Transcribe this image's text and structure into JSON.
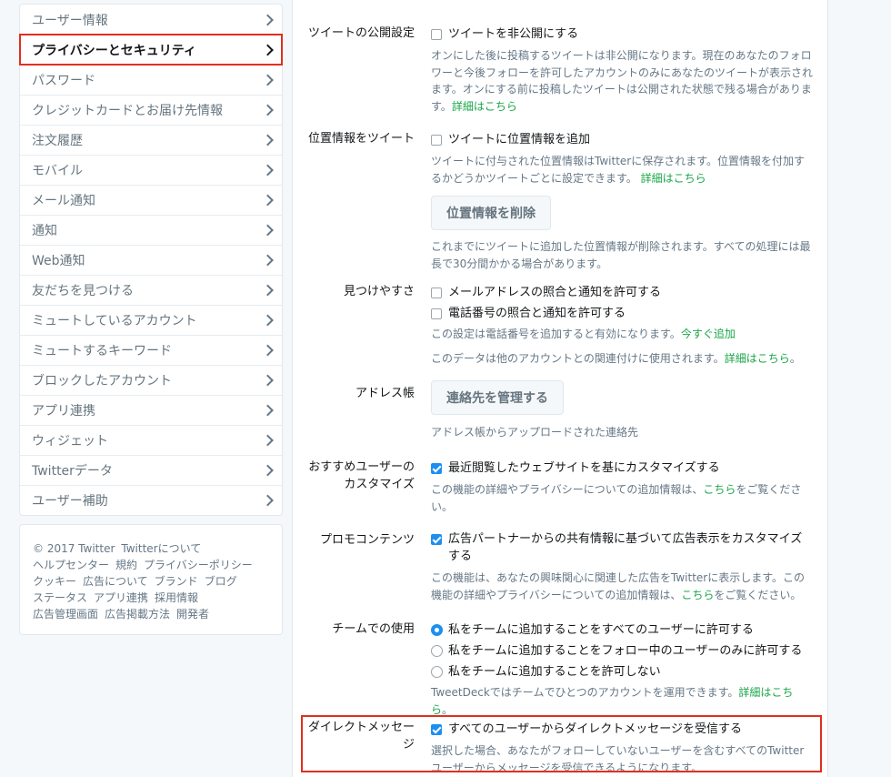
{
  "sidebar": {
    "items": [
      {
        "label": "ユーザー情報"
      },
      {
        "label": "プライバシーとセキュリティ"
      },
      {
        "label": "パスワード"
      },
      {
        "label": "クレジットカードとお届け先情報"
      },
      {
        "label": "注文履歴"
      },
      {
        "label": "モバイル"
      },
      {
        "label": "メール通知"
      },
      {
        "label": "通知"
      },
      {
        "label": "Web通知"
      },
      {
        "label": "友だちを見つける"
      },
      {
        "label": "ミュートしているアカウント"
      },
      {
        "label": "ミュートするキーワード"
      },
      {
        "label": "ブロックしたアカウント"
      },
      {
        "label": "アプリ連携"
      },
      {
        "label": "ウィジェット"
      },
      {
        "label": "Twitterデータ"
      },
      {
        "label": "ユーザー補助"
      }
    ]
  },
  "footer": {
    "copyright": "© 2017 Twitter",
    "links": [
      "Twitterについて",
      "ヘルプセンター",
      "規約",
      "プライバシーポリシー",
      "クッキー",
      "広告について",
      "ブランド",
      "ブログ",
      "ステータス",
      "アプリ連携",
      "採用情報",
      "広告管理画面",
      "広告掲載方法",
      "開発者"
    ]
  },
  "protect": {
    "label": "ツイートの公開設定",
    "option": "ツイートを非公開にする",
    "help": "オンにした後に投稿するツイートは非公開になります。現在のあなたのフォロワーと今後フォローを許可したアカウントのみにあなたのツイートが表示されます。オンにする前に投稿したツイートは公開された状態で残る場合があります。",
    "link": "詳細はこちら"
  },
  "location": {
    "label": "位置情報をツイート",
    "option": "ツイートに位置情報を追加",
    "help": "ツイートに付与された位置情報はTwitterに保存されます。位置情報を付加するかどうかツイートごとに設定できます。",
    "link": "詳細はこちら",
    "button": "位置情報を削除",
    "help2": "これまでにツイートに追加した位置情報が削除されます。すべての処理には最長で30分間かかる場合があります。"
  },
  "discover": {
    "label": "見つけやすさ",
    "option_email": "メールアドレスの照合と通知を許可する",
    "option_phone": "電話番号の照合と通知を許可する",
    "help_phone": "この設定は電話番号を追加すると有効になります。",
    "link_phone": "今すぐ追加",
    "help_data": "このデータは他のアカウントとの関連付けに使用されます。",
    "link_data": "詳細はこちら"
  },
  "addressbook": {
    "label": "アドレス帳",
    "button": "連絡先を管理する",
    "help": "アドレス帳からアップロードされた連絡先"
  },
  "personalize": {
    "label": "おすすめユーザーのカスタマイズ",
    "option": "最近閲覧したウェブサイトを基にカスタマイズする",
    "help_pre": "この機能の詳細やプライバシーについての追加情報は、",
    "link": "こちら",
    "help_post": "をご覧ください。"
  },
  "promoted": {
    "label": "プロモコンテンツ",
    "option": "広告パートナーからの共有情報に基づいて広告表示をカスタマイズする",
    "help_pre": "この機能は、あなたの興味関心に関連した広告をTwitterに表示します。この機能の詳細やプライバシーについての追加情報は、",
    "link": "こちら",
    "help_post": "をご覧ください。"
  },
  "teams": {
    "label": "チームでの使用",
    "option_all": "私をチームに追加することをすべてのユーザーに許可する",
    "option_following": "私をチームに追加することをフォロー中のユーザーのみに許可する",
    "option_none": "私をチームに追加することを許可しない",
    "help": "TweetDeckではチームでひとつのアカウントを運用できます。",
    "link": "詳細はこちら"
  },
  "dm": {
    "label": "ダイレクトメッセージ",
    "option": "すべてのユーザーからダイレクトメッセージを受信する",
    "help": "選択した場合、あなたがフォローしていないユーザーを含むすべてのTwitterユーザーからメッセージを受信できるようになります。"
  },
  "colors": {
    "highlight": "#e0301e",
    "link": "#19a648",
    "checkbox": "#1d8ff0"
  }
}
